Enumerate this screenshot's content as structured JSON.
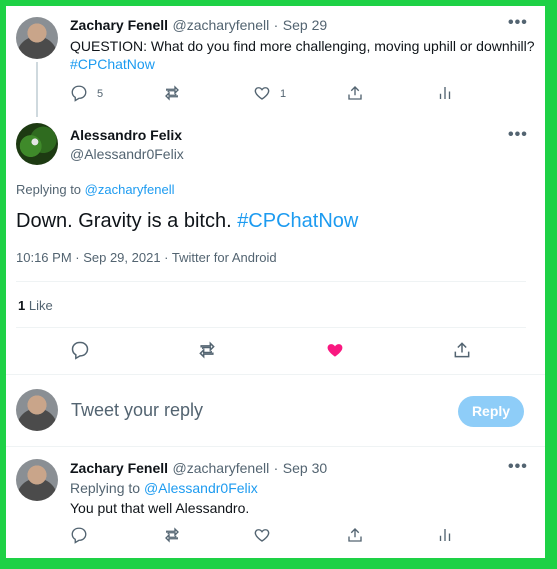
{
  "tweet1": {
    "name": "Zachary Fenell",
    "handle": "@zacharyfenell",
    "separator": "·",
    "date": "Sep 29",
    "text": "QUESTION: What do you find more challenging, moving uphill or downhill?",
    "hashtag": "#CPChatNow",
    "reply_count": "5",
    "like_count": "1"
  },
  "main_tweet": {
    "name": "Alessandro Felix",
    "handle": "@Alessandr0Felix",
    "replying_prefix": "Replying to",
    "replying_to": "@zacharyfenell",
    "text": "Down. Gravity is a bitch.",
    "hashtag": "#CPChatNow",
    "meta": "10:16 PM · Sep 29, 2021 · Twitter for Android",
    "likes_count": "1",
    "likes_label": "Like",
    "liked": true,
    "like_color": "#f91880"
  },
  "compose": {
    "placeholder": "Tweet your reply",
    "button": "Reply"
  },
  "tweet3": {
    "name": "Zachary Fenell",
    "handle": "@zacharyfenell",
    "separator": "·",
    "date": "Sep 30",
    "replying_prefix": "Replying to",
    "replying_to": "@Alessandr0Felix",
    "text": "You put that well Alessandro."
  },
  "colors": {
    "border": "#1ed145",
    "link": "#1d9bf0",
    "reply_button": "#8ecdf8"
  }
}
